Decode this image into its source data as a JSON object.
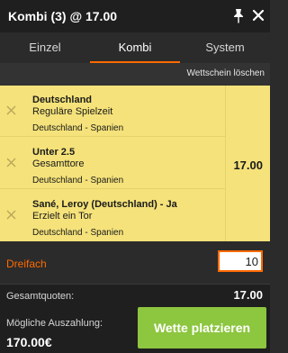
{
  "header": {
    "title": "Kombi (3) @ 17.00"
  },
  "tabs": [
    {
      "label": "Einzel"
    },
    {
      "label": "Kombi"
    },
    {
      "label": "System"
    }
  ],
  "clear_label": "Wettschein löschen",
  "bets": [
    {
      "selection": "Deutschland",
      "market": "Reguläre Spielzeit",
      "event": "Deutschland - Spanien"
    },
    {
      "selection": "Unter 2.5",
      "market": "Gesamttore",
      "event": "Deutschland - Spanien"
    },
    {
      "selection": "Sané, Leroy (Deutschland) - Ja",
      "market": "Erzielt ein Tor",
      "event": "Deutschland - Spanien"
    }
  ],
  "combined_odds": "17.00",
  "stake": {
    "label": "Dreifach",
    "value": "10"
  },
  "summary": {
    "total_odds_label": "Gesamtquoten:",
    "total_odds_value": "17.00",
    "payout_label": "Mögliche Auszahlung:",
    "payout_value": "170.00€"
  },
  "place_button": "Wette platzieren",
  "colors": {
    "accent": "#ff6a00",
    "slip_background": "#f5e27a",
    "place_button": "#8dc63f"
  }
}
